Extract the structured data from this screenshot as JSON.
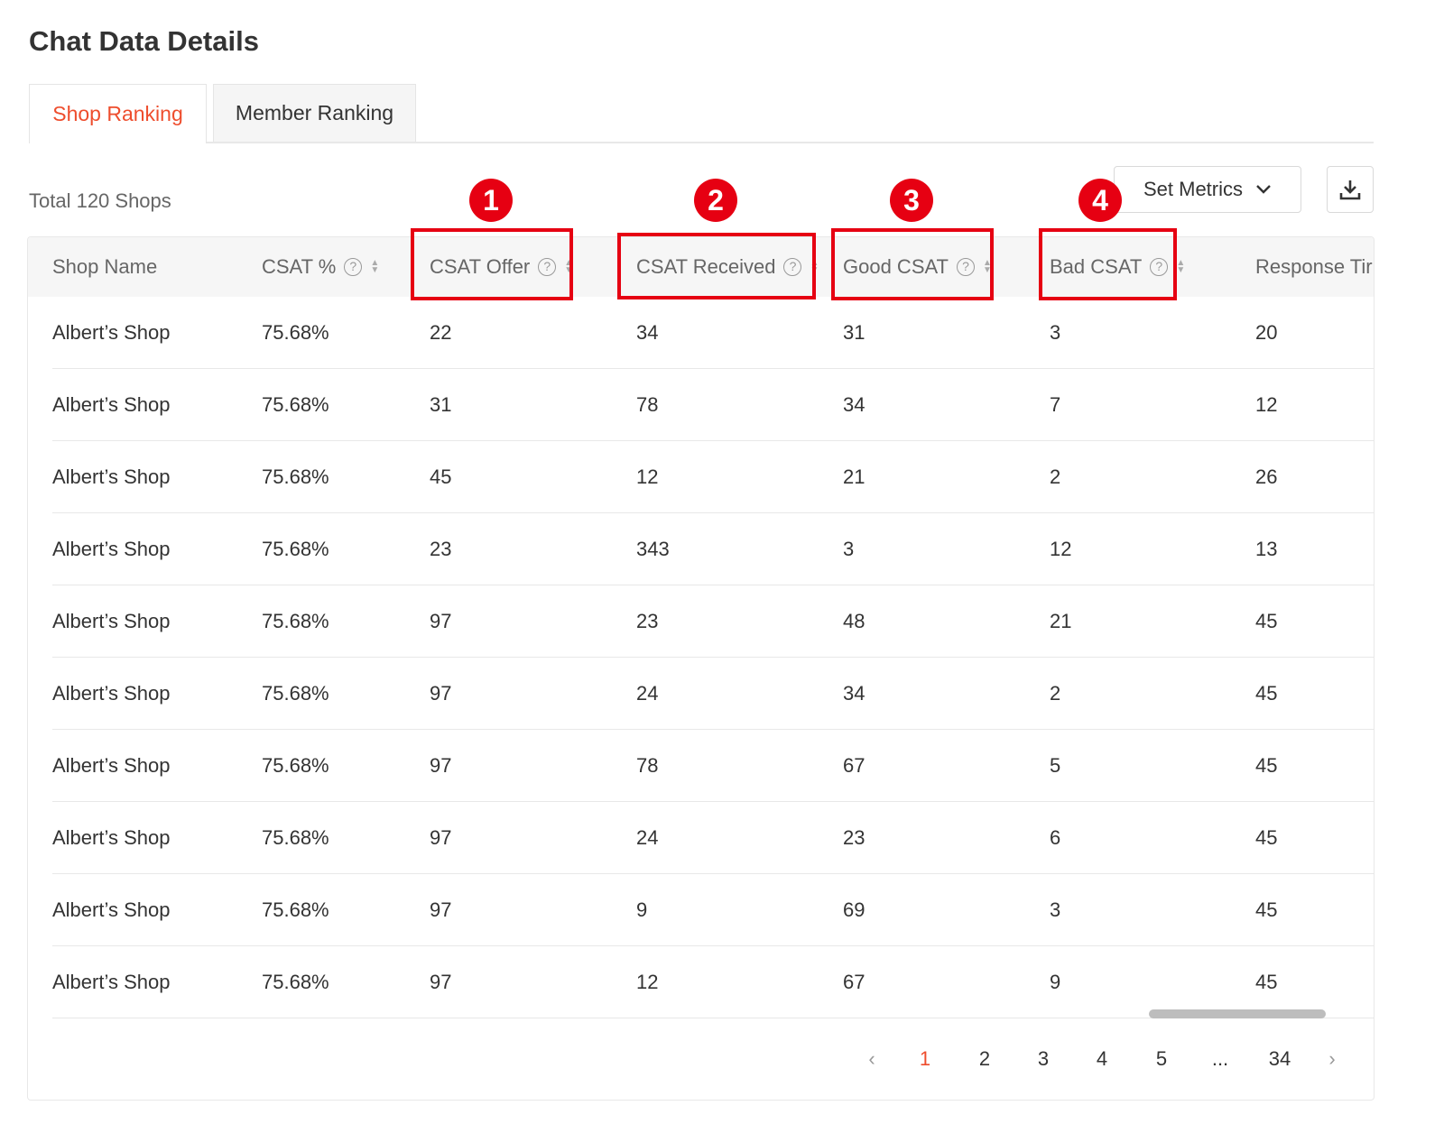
{
  "page_title": "Chat Data Details",
  "tabs": [
    {
      "label": "Shop Ranking",
      "active": true
    },
    {
      "label": "Member Ranking",
      "active": false
    }
  ],
  "toolbar": {
    "total_label": "Total 120 Shops",
    "set_metrics_label": "Set Metrics"
  },
  "table": {
    "columns": [
      "Shop Name",
      "CSAT %",
      "CSAT Offer",
      "CSAT Received",
      "Good CSAT",
      "Bad CSAT",
      "Response Tir"
    ],
    "rows": [
      [
        "Albert’s Shop",
        "75.68%",
        "22",
        "34",
        "31",
        "3",
        "20"
      ],
      [
        "Albert’s Shop",
        "75.68%",
        "31",
        "78",
        "34",
        "7",
        "12"
      ],
      [
        "Albert’s Shop",
        "75.68%",
        "45",
        "12",
        "21",
        "2",
        "26"
      ],
      [
        "Albert’s Shop",
        "75.68%",
        "23",
        "343",
        "3",
        "12",
        "13"
      ],
      [
        "Albert’s Shop",
        "75.68%",
        "97",
        "23",
        "48",
        "21",
        "45"
      ],
      [
        "Albert’s Shop",
        "75.68%",
        "97",
        "24",
        "34",
        "2",
        "45"
      ],
      [
        "Albert’s Shop",
        "75.68%",
        "97",
        "78",
        "67",
        "5",
        "45"
      ],
      [
        "Albert’s Shop",
        "75.68%",
        "97",
        "24",
        "23",
        "6",
        "45"
      ],
      [
        "Albert’s Shop",
        "75.68%",
        "97",
        "9",
        "69",
        "3",
        "45"
      ],
      [
        "Albert’s Shop",
        "75.68%",
        "97",
        "12",
        "67",
        "9",
        "45"
      ]
    ]
  },
  "pagination": {
    "prev": "‹",
    "pages": [
      "1",
      "2",
      "3",
      "4",
      "5",
      "...",
      "34"
    ],
    "active_page": "1",
    "next": "›"
  },
  "annotations": [
    "1",
    "2",
    "3",
    "4"
  ],
  "colors": {
    "accent": "#ee4d2d",
    "highlight": "#e60012"
  },
  "icons": {
    "help": "question-circle-icon",
    "sort": "sort-icon",
    "dropdown": "chevron-down-icon",
    "download": "download-icon"
  }
}
